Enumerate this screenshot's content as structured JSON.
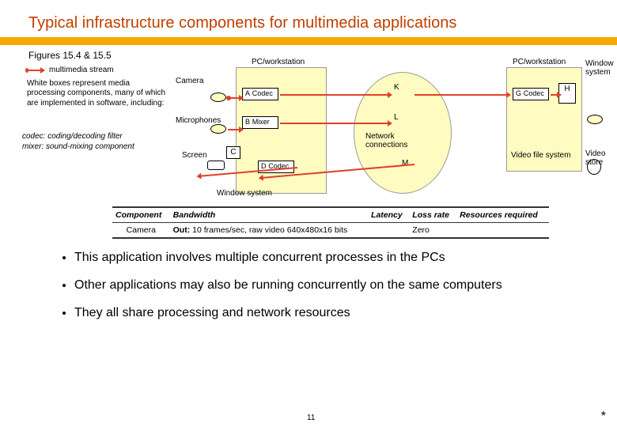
{
  "title": "Typical infrastructure components for multimedia applications",
  "figref": "Figures 15.4 & 15.5",
  "legend": {
    "stream_label": "multimedia stream",
    "white_boxes": "White boxes represent media processing components, many of which are implemented in software, including:",
    "codec_line": "codec: coding/decoding filter",
    "mixer_line": "mixer: sound-mixing component"
  },
  "pc_label_left": "PC/workstation",
  "pc_label_right": "PC/workstation",
  "window_system_right": "Window system",
  "video_file_system": "Video file system",
  "video_store": "Video store",
  "network_connections": "Network connections",
  "window_system_bottom": "Window system",
  "devices": {
    "camera": "Camera",
    "microphones": "Microphones",
    "screen": "Screen"
  },
  "boxes": {
    "A": "A",
    "A_label": "Codec",
    "B": "B",
    "B_label": "Mixer",
    "C": "C",
    "D": "D",
    "D_label": "Codec",
    "G": "G",
    "G_label": "Codec",
    "H": "H",
    "K": "K",
    "L": "L",
    "M": "M"
  },
  "table": {
    "headers": [
      "Component",
      "Bandwidth",
      "Latency",
      "Loss rate",
      "Resources required"
    ],
    "rows": [
      {
        "component": "Camera",
        "bw_dir": "Out:",
        "bandwidth": "10 frames/sec, raw video 640x480x16 bits",
        "latency": "",
        "loss": "Zero",
        "resources": ""
      }
    ]
  },
  "bullets": [
    "This application involves multiple concurrent processes in the PCs",
    "Other applications may also be running concurrently on the same computers",
    "They all share processing and network resources"
  ],
  "footer_page": "11",
  "footer_mark": "*"
}
